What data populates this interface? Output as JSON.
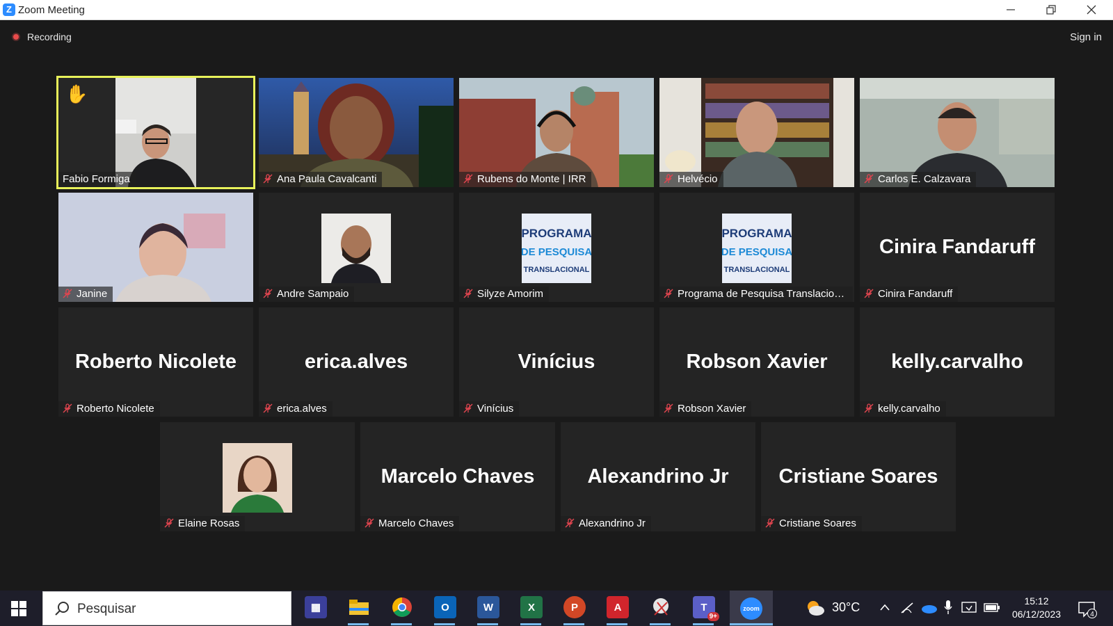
{
  "window": {
    "title": "Zoom Meeting",
    "logo_letter": "Z"
  },
  "toolbar": {
    "recording_label": "Recording",
    "signin_label": "Sign in"
  },
  "participants": {
    "fabio": {
      "name": "Fabio Formiga",
      "hand_raised": true,
      "active_speaker": true
    },
    "ana": {
      "name": "Ana Paula Cavalcanti"
    },
    "rubens": {
      "name": "Rubens do Monte | IRR"
    },
    "helvecio": {
      "name": "Helvécio"
    },
    "carlos": {
      "name": "Carlos E. Calzavara"
    },
    "janine": {
      "name": "Janine"
    },
    "andre": {
      "name": "Andre Sampaio"
    },
    "silyze": {
      "name": "Silyze Amorim",
      "avatar_text": [
        "PROGRAMA",
        "DE PESQUISA",
        "TRANSLACIONAL"
      ]
    },
    "programa": {
      "name": "Programa de Pesquisa Translacion...",
      "avatar_text": [
        "PROGRAMA",
        "DE PESQUISA",
        "TRANSLACIONAL"
      ]
    },
    "cinira": {
      "name": "Cinira Fandaruff",
      "big_name": "Cinira Fandaruff"
    },
    "roberto": {
      "name": "Roberto Nicolete",
      "big_name": "Roberto Nicolete"
    },
    "erica": {
      "name": "erica.alves",
      "big_name": "erica.alves"
    },
    "vinicius": {
      "name": "Vinícius",
      "big_name": "Vinícius"
    },
    "robson": {
      "name": "Robson Xavier",
      "big_name": "Robson Xavier"
    },
    "kelly": {
      "name": "kelly.carvalho",
      "big_name": "kelly.carvalho"
    },
    "elaine": {
      "name": "Elaine Rosas"
    },
    "marcelo": {
      "name": "Marcelo Chaves",
      "big_name": "Marcelo Chaves"
    },
    "alexandrino": {
      "name": "Alexandrino Jr",
      "big_name": "Alexandrino Jr"
    },
    "cristiane": {
      "name": "Cristiane Soares",
      "big_name": "Cristiane Soares"
    }
  },
  "taskbar": {
    "search_placeholder": "Pesquisar",
    "apps": [
      "calendar-app-icon",
      "file-explorer-icon",
      "chrome-icon",
      "outlook-icon",
      "word-icon",
      "excel-icon",
      "powerpoint-icon",
      "acrobat-icon",
      "snipping-tool-icon",
      "teams-icon",
      "zoom-icon"
    ],
    "teams_badge": "9+",
    "zoom_label": "zoom",
    "weather": "30°C",
    "time": "15:12",
    "date": "06/12/2023",
    "notification_count": "4"
  },
  "colors": {
    "active_speaker_outline": "#e8f25a",
    "muted_mic": "#e0454f",
    "background": "#1a1a1a",
    "tile": "#242424"
  }
}
